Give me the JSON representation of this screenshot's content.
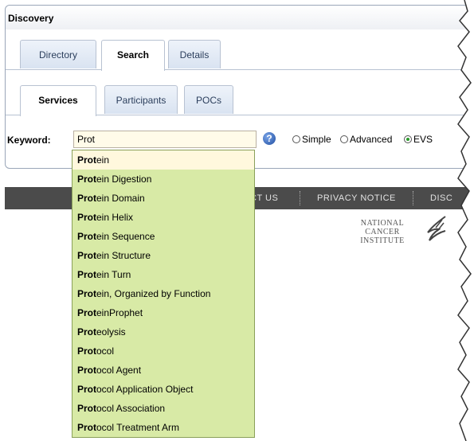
{
  "panel": {
    "title": "Discovery"
  },
  "main_tabs": [
    {
      "label": "Directory",
      "active": false
    },
    {
      "label": "Search",
      "active": true
    },
    {
      "label": "Details",
      "active": false
    }
  ],
  "sub_tabs": [
    {
      "label": "Services",
      "active": true
    },
    {
      "label": "Participants",
      "active": false
    },
    {
      "label": "POCs",
      "active": false
    }
  ],
  "search": {
    "keyword_label": "Keyword:",
    "value": "Prot",
    "help_icon": "help-icon",
    "modes": [
      {
        "label": "Simple",
        "selected": false
      },
      {
        "label": "Advanced",
        "selected": false
      },
      {
        "label": "EVS",
        "selected": true
      }
    ]
  },
  "footer": {
    "items": [
      "CT US",
      "PRIVACY NOTICE",
      "DISC"
    ]
  },
  "logo_text": {
    "line1": "NATIONAL",
    "line2": "CANCER",
    "line3": "INSTITUTE"
  },
  "suggestions": [
    {
      "match": "Prot",
      "rest": "ein",
      "highlighted": true
    },
    {
      "match": "Prot",
      "rest": "ein Digestion"
    },
    {
      "match": "Prot",
      "rest": "ein Domain"
    },
    {
      "match": "Prot",
      "rest": "ein Helix"
    },
    {
      "match": "Prot",
      "rest": "ein Sequence"
    },
    {
      "match": "Prot",
      "rest": "ein Structure"
    },
    {
      "match": "Prot",
      "rest": "ein Turn"
    },
    {
      "match": "Prot",
      "rest": "ein, Organized by Function"
    },
    {
      "match": "Prot",
      "rest": "einProphet"
    },
    {
      "match": "Prot",
      "rest": "eolysis"
    },
    {
      "match": "Prot",
      "rest": "ocol"
    },
    {
      "match": "Prot",
      "rest": "ocol Agent"
    },
    {
      "match": "Prot",
      "rest": "ocol Application Object"
    },
    {
      "match": "Prot",
      "rest": "ocol Association"
    },
    {
      "match": "Prot",
      "rest": "ocol Treatment Arm"
    }
  ],
  "colors": {
    "dropdown_bg": "#d8eaa6",
    "highlight_bg": "#fff8dd",
    "footer_bg": "#4b4b4b"
  }
}
